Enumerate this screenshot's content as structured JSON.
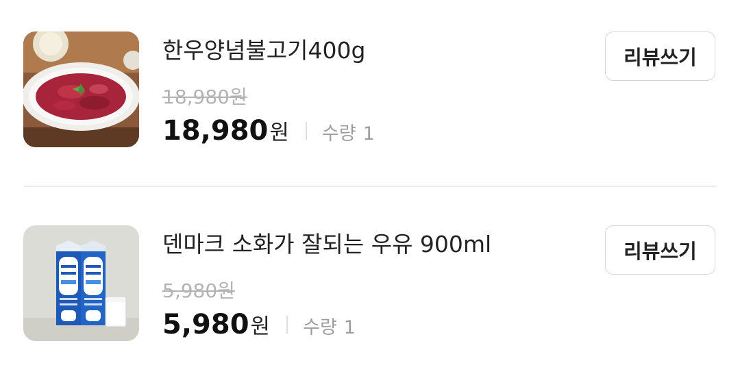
{
  "orders": [
    {
      "product_name": "한우양념불고기400g",
      "original_price": "18,980원",
      "price_value": "18,980",
      "price_unit": "원",
      "quantity_label": "수량",
      "quantity_value": "1",
      "review_button_label": "리뷰쓰기",
      "thumbnail_icon": "bulgogi-product-photo"
    },
    {
      "product_name": "덴마크 소화가 잘되는 우유 900ml",
      "original_price": "5,980원",
      "price_value": "5,980",
      "price_unit": "원",
      "quantity_label": "수량",
      "quantity_value": "1",
      "review_button_label": "리뷰쓰기",
      "thumbnail_icon": "milk-carton-product-photo"
    }
  ],
  "colors": {
    "text_primary": "#222222",
    "text_strike": "#b3b3b3",
    "text_muted": "#9e9e9e",
    "border": "#d6d6d6",
    "divider": "#ececec"
  }
}
